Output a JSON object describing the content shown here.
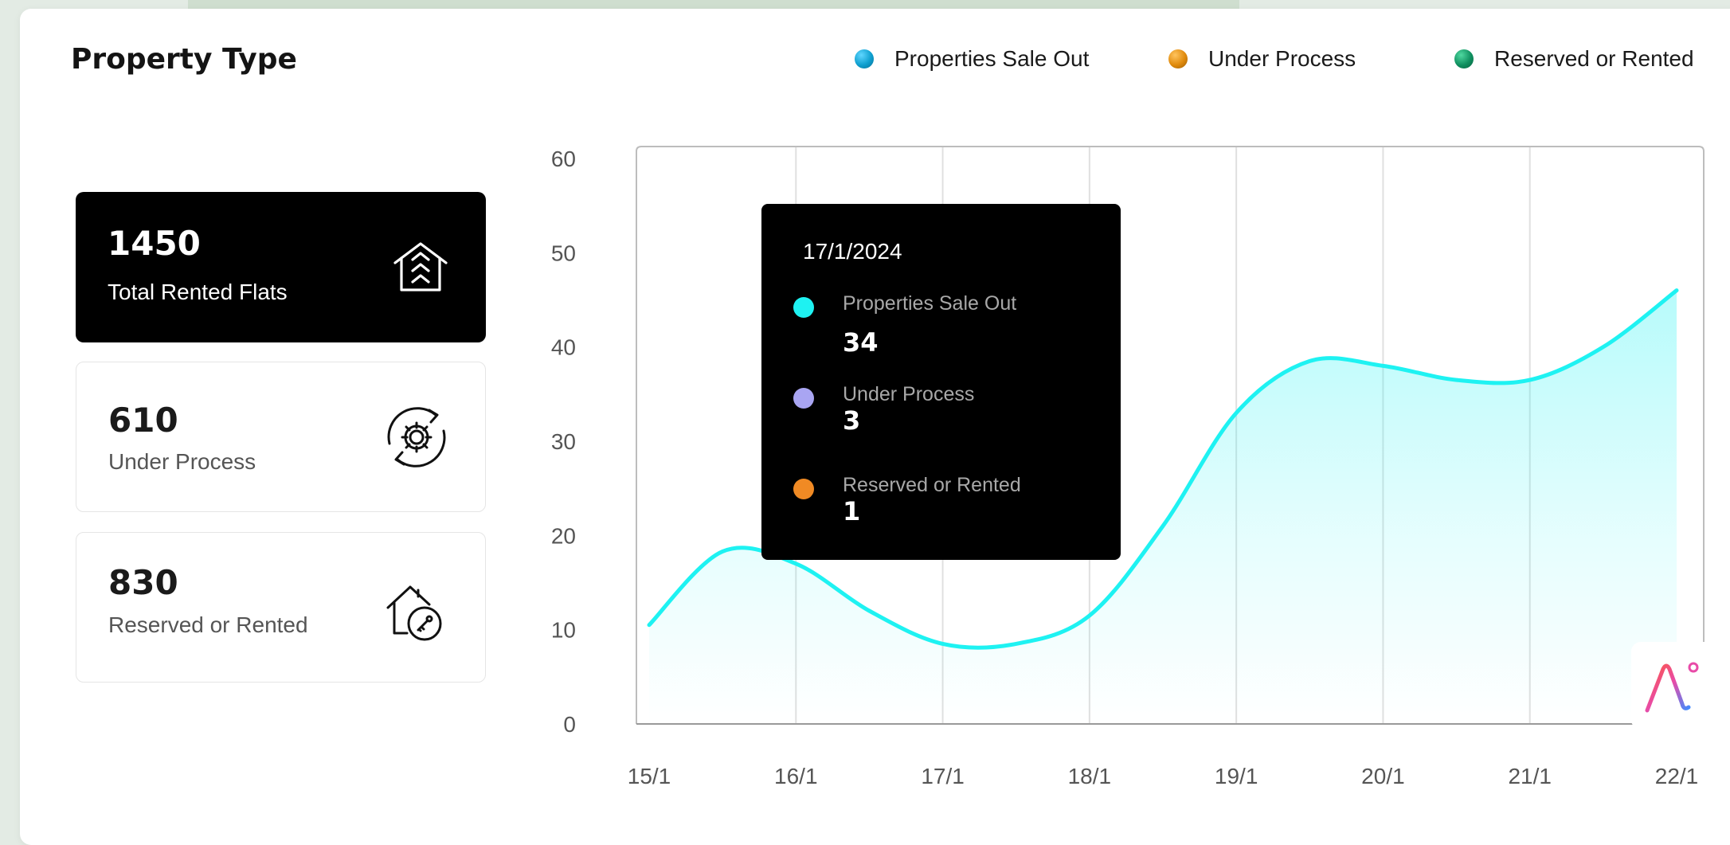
{
  "title": "Property Type",
  "legend": [
    {
      "label": "Properties Sale Out",
      "color": "#0e9fcf"
    },
    {
      "label": "Under Process",
      "color": "#e08a0c"
    },
    {
      "label": "Reserved or Rented",
      "color": "#0f8f5f"
    }
  ],
  "stats": [
    {
      "value": "1450",
      "label": "Total Rented Flats",
      "icon": "house-stack-icon"
    },
    {
      "value": "610",
      "label": "Under Process",
      "icon": "gear-cycle-icon"
    },
    {
      "value": "830",
      "label": "Reserved or Rented",
      "icon": "house-key-icon"
    }
  ],
  "tooltip": {
    "date": "17/1/2024",
    "items": [
      {
        "label": "Properties Sale Out",
        "value": "34",
        "color": "#1ef2f2"
      },
      {
        "label": "Under Process",
        "value": "3",
        "color": "#a9a5f2"
      },
      {
        "label": "Reserved or Rented",
        "value": "1",
        "color": "#f08a24"
      }
    ]
  },
  "chart_data": {
    "type": "area",
    "categories": [
      "15/1",
      "16/1",
      "17/1",
      "18/1",
      "19/1",
      "20/1",
      "21/1",
      "22/1"
    ],
    "x": [
      0,
      0.5,
      1,
      1.5,
      2,
      2.5,
      3,
      3.5,
      4,
      4.5,
      5,
      5.5,
      6,
      6.5,
      7
    ],
    "series": [
      {
        "values": [
          10.5,
          18.3,
          17,
          12,
          8.5,
          8.5,
          11.5,
          21,
          33,
          38.5,
          38,
          36.5,
          36.5,
          40,
          46
        ],
        "color": "#1ef2f2"
      }
    ],
    "ylim": [
      0,
      60
    ],
    "yticks": [
      0,
      10,
      20,
      30,
      40,
      50,
      60
    ],
    "grid": "vertical"
  }
}
